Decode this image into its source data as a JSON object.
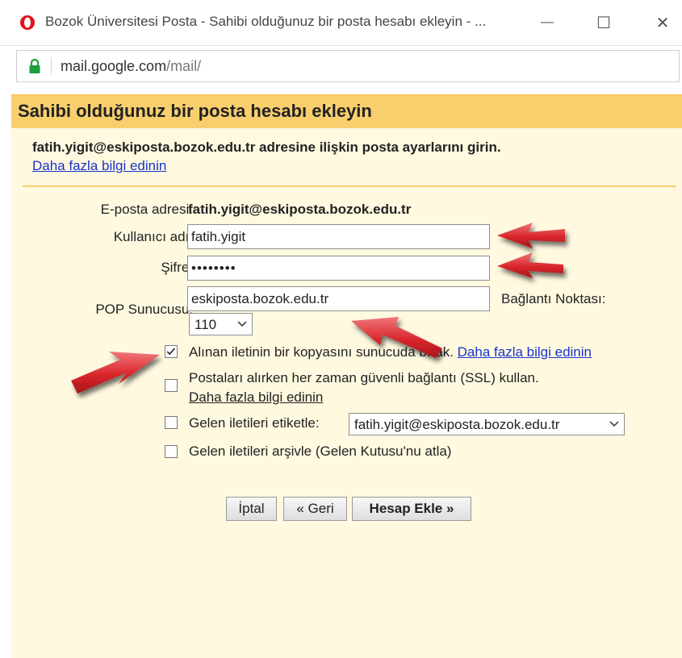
{
  "window": {
    "title": "Bozok Üniversitesi Posta - Sahibi olduğunuz bir posta hesabı ekleyin - ...",
    "minimize_glyph": "—",
    "maximize_glyph": "☐",
    "close_glyph": "✕"
  },
  "address_bar": {
    "domain": "mail.google.com",
    "path": "/mail/"
  },
  "dialog": {
    "title": "Sahibi olduğunuz bir posta hesabı ekleyin",
    "intro": "fatih.yigit@eskiposta.bozok.edu.tr adresine ilişkin posta ayarlarını girin.",
    "intro_link": "Daha fazla bilgi edinin"
  },
  "form": {
    "email_label": "E-posta adresi:",
    "email_value": "fatih.yigit@eskiposta.bozok.edu.tr",
    "username_label": "Kullanıcı adı:",
    "username_value": "fatih.yigit",
    "password_label": "Şifre:",
    "password_value": "••••••••",
    "pop_label": "POP Sunucusu:",
    "pop_value": "eskiposta.bozok.edu.tr",
    "port_label": "Bağlantı Noktası:",
    "port_value": "110"
  },
  "options": {
    "leave_copy": {
      "text": "Alınan iletinin bir kopyasını sunucuda bırak.",
      "link": "Daha fazla bilgi edinin",
      "checked": true
    },
    "ssl": {
      "text": "Postaları alırken her zaman güvenli bağlantı (SSL) kullan.",
      "link": "Daha fazla bilgi edinin",
      "checked": false
    },
    "label": {
      "text": "Gelen iletileri etiketle:",
      "select_value": "fatih.yigit@eskiposta.bozok.edu.tr",
      "checked": false
    },
    "archive": {
      "text": "Gelen iletileri arşivle (Gelen Kutusu'nu atla)",
      "checked": false
    }
  },
  "buttons": {
    "cancel": "İptal",
    "back": "« Geri",
    "add_account": "Hesap Ekle »"
  },
  "colors": {
    "header": "#f9cf6d",
    "content_bg": "#fff9e0",
    "link": "#1a33cc",
    "annotation_arrow": "#d9262b"
  },
  "icons": {
    "browser_logo": "opera-logo",
    "lock": "lock-icon",
    "annotation": "red-arrow-icon"
  }
}
